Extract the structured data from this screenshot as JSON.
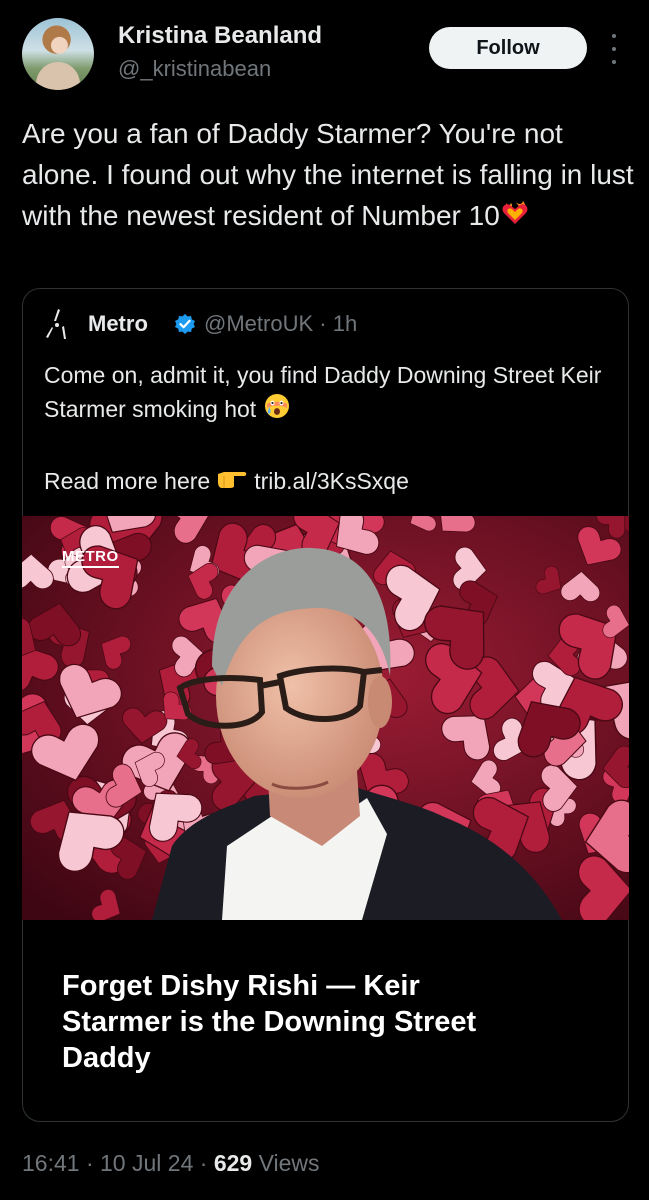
{
  "author": {
    "name": "Kristina Beanland",
    "handle": "@_kristinabean"
  },
  "follow_label": "Follow",
  "tweet_text": "Are you a fan of Daddy Starmer? You're not alone. I found out why the internet is falling in lust with the newest resident of Number 10",
  "quote": {
    "name": "Metro",
    "handle": "@MetroUK",
    "separator": "·",
    "time": "1h",
    "body": "Come on, admit it, you find Daddy Downing Street Keir Starmer smoking hot",
    "read_more": "Read more here",
    "link": "trib.al/3KsSxqe",
    "image_watermark": "METRO",
    "headline": "Forget Dishy Rishi — Keir Starmer is the Downing Street Daddy"
  },
  "footer": {
    "time": "16:41",
    "sep": "·",
    "date": "10 Jul 24",
    "views_count": "629",
    "views_label": "Views"
  },
  "icons": {
    "more": "more-vertical-icon",
    "verified": "verified-badge-icon",
    "emoji_heart": "heart-on-fire-emoji",
    "emoji_flushed": "face-with-tears-emoji",
    "emoji_point": "pointing-right-emoji"
  },
  "colors": {
    "background": "#000000",
    "text": "#e7e9ea",
    "muted": "#71767b",
    "verified": "#1d9bf0",
    "border": "#2f3336"
  }
}
